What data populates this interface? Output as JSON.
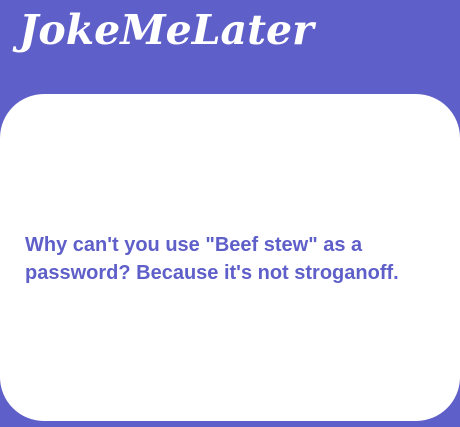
{
  "app": {
    "title": "JokeMeLater"
  },
  "joke": {
    "text": "Why can't you use \"Beef stew\" as a password? Because it's not stroganoff."
  },
  "colors": {
    "background": "#5f5fc9",
    "card": "#ffffff",
    "joke_text": "#5f5fc9",
    "title_text": "#ffffff"
  }
}
